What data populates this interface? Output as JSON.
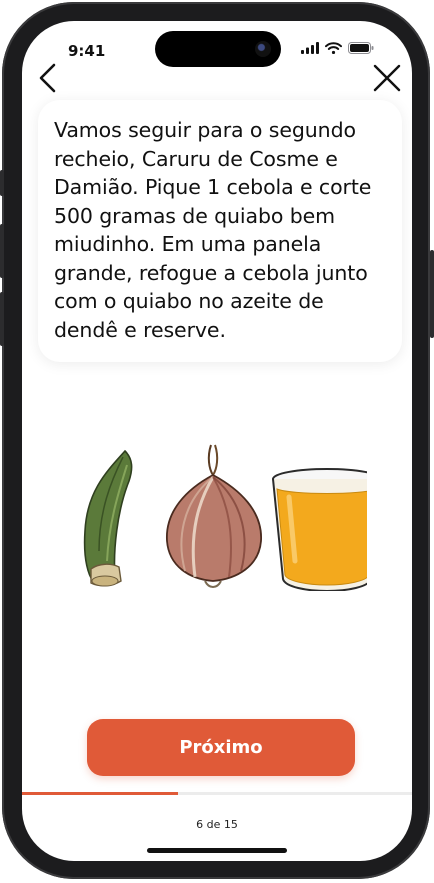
{
  "status_bar": {
    "time": "9:41",
    "icons": [
      "signal-icon",
      "wifi-icon",
      "battery-icon"
    ]
  },
  "nav": {
    "back_icon": "chevron-left-icon",
    "close_icon": "close-icon"
  },
  "instruction": {
    "text": "Vamos seguir para o segundo recheio, Caruru de Cosme e Damião. Pique 1 cebola e corte 500 gramas de quiabo bem miudinho. Em uma panela grande, refogue a cebola junto com o quiabo no azeite de dendê e reserve."
  },
  "illustration": {
    "items": [
      "okra-illustration",
      "onion-illustration",
      "palm-oil-glass-illustration"
    ]
  },
  "next_button": {
    "label": "Próximo"
  },
  "progress": {
    "current": 6,
    "total": 15,
    "fraction": 0.4,
    "label": "6 de 15"
  },
  "colors": {
    "accent": "#e05a38",
    "text": "#111111",
    "background": "#ffffff"
  }
}
